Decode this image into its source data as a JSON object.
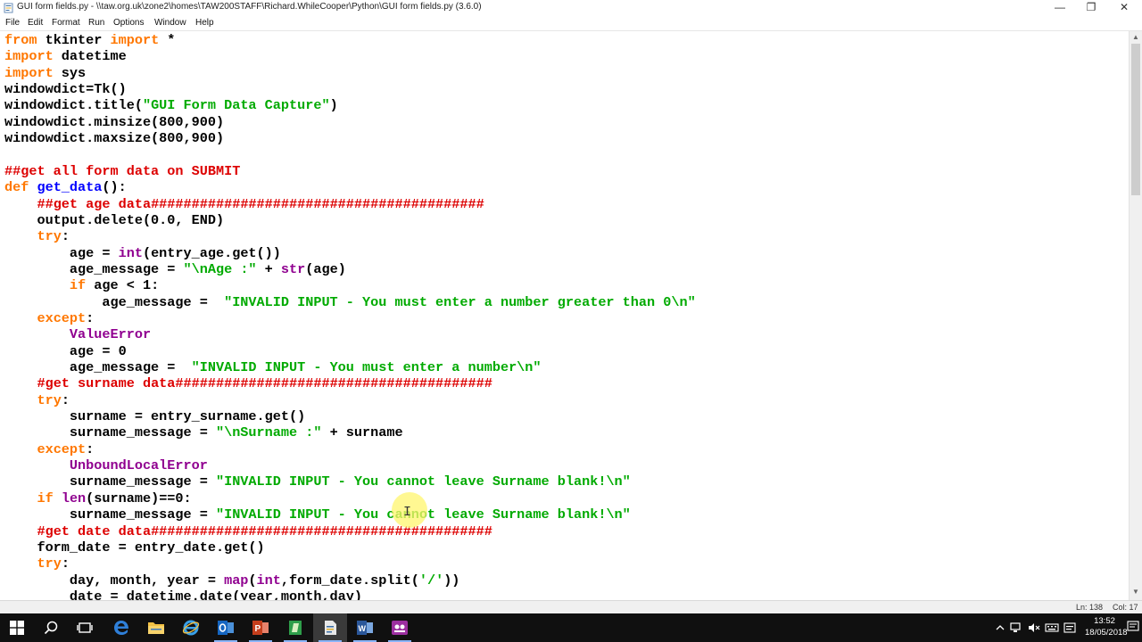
{
  "window": {
    "title": "GUI form fields.py - \\\\taw.org.uk\\zone2\\homes\\TAW200STAFF\\Richard.WhileCooper\\Python\\GUI form fields.py (3.6.0)",
    "minimize_glyph": "—",
    "maximize_glyph": "❐",
    "close_glyph": "✕"
  },
  "menu": {
    "items": [
      "File",
      "Edit",
      "Format",
      "Run",
      "Options",
      "Window",
      "Help"
    ]
  },
  "editor": {
    "lines": [
      [
        {
          "t": "from",
          "c": "kw"
        },
        {
          "t": " tkinter "
        },
        {
          "t": "import",
          "c": "kw"
        },
        {
          "t": " *"
        }
      ],
      [
        {
          "t": "import",
          "c": "kw"
        },
        {
          "t": " datetime"
        }
      ],
      [
        {
          "t": "import",
          "c": "kw"
        },
        {
          "t": " sys"
        }
      ],
      [
        {
          "t": "windowdict=Tk()"
        }
      ],
      [
        {
          "t": "windowdict.title("
        },
        {
          "t": "\"GUI Form Data Capture\"",
          "c": "str"
        },
        {
          "t": ")"
        }
      ],
      [
        {
          "t": "windowdict.minsize(800,900)"
        }
      ],
      [
        {
          "t": "windowdict.maxsize(800,900)"
        }
      ],
      [],
      [
        {
          "t": "##get all form data on SUBMIT",
          "c": "cm"
        }
      ],
      [
        {
          "t": "def",
          "c": "kw"
        },
        {
          "t": " "
        },
        {
          "t": "get_data",
          "c": "df"
        },
        {
          "t": "():"
        }
      ],
      [
        {
          "t": "    "
        },
        {
          "t": "##get age data#########################################",
          "c": "cm"
        }
      ],
      [
        {
          "t": "    output.delete(0.0, END)"
        }
      ],
      [
        {
          "t": "    "
        },
        {
          "t": "try",
          "c": "kw"
        },
        {
          "t": ":"
        }
      ],
      [
        {
          "t": "        age = "
        },
        {
          "t": "int",
          "c": "bi"
        },
        {
          "t": "(entry_age.get())"
        }
      ],
      [
        {
          "t": "        age_message = "
        },
        {
          "t": "\"\\nAge :\"",
          "c": "str"
        },
        {
          "t": " + "
        },
        {
          "t": "str",
          "c": "bi"
        },
        {
          "t": "(age)"
        }
      ],
      [
        {
          "t": "        "
        },
        {
          "t": "if",
          "c": "kw"
        },
        {
          "t": " age < 1:"
        }
      ],
      [
        {
          "t": "            age_message =  "
        },
        {
          "t": "\"INVALID INPUT - You must enter a number greater than 0\\n\"",
          "c": "str"
        }
      ],
      [
        {
          "t": "    "
        },
        {
          "t": "except",
          "c": "kw"
        },
        {
          "t": ":"
        }
      ],
      [
        {
          "t": "        "
        },
        {
          "t": "ValueError",
          "c": "bi"
        }
      ],
      [
        {
          "t": "        age = 0"
        }
      ],
      [
        {
          "t": "        age_message =  "
        },
        {
          "t": "\"INVALID INPUT - You must enter a number\\n\"",
          "c": "str"
        }
      ],
      [
        {
          "t": "    "
        },
        {
          "t": "#get surname data#######################################",
          "c": "cm"
        }
      ],
      [
        {
          "t": "    "
        },
        {
          "t": "try",
          "c": "kw"
        },
        {
          "t": ":"
        }
      ],
      [
        {
          "t": "        surname = entry_surname.get()"
        }
      ],
      [
        {
          "t": "        surname_message = "
        },
        {
          "t": "\"\\nSurname :\"",
          "c": "str"
        },
        {
          "t": " + surname"
        }
      ],
      [
        {
          "t": "    "
        },
        {
          "t": "except",
          "c": "kw"
        },
        {
          "t": ":"
        }
      ],
      [
        {
          "t": "        "
        },
        {
          "t": "UnboundLocalError",
          "c": "bi"
        }
      ],
      [
        {
          "t": "        surname_message = "
        },
        {
          "t": "\"INVALID INPUT - You cannot leave Surname blank!\\n\"",
          "c": "str"
        }
      ],
      [
        {
          "t": "    "
        },
        {
          "t": "if",
          "c": "kw"
        },
        {
          "t": " "
        },
        {
          "t": "len",
          "c": "bi"
        },
        {
          "t": "(surname)==0:"
        }
      ],
      [
        {
          "t": "        surname_message = "
        },
        {
          "t": "\"INVALID INPUT - You cannot leave Surname blank!\\n\"",
          "c": "str"
        }
      ],
      [
        {
          "t": "    "
        },
        {
          "t": "#get date data##########################################",
          "c": "cm"
        }
      ],
      [
        {
          "t": "    form_date = entry_date.get()"
        }
      ],
      [
        {
          "t": "    "
        },
        {
          "t": "try",
          "c": "kw"
        },
        {
          "t": ":"
        }
      ],
      [
        {
          "t": "        day, month, year = "
        },
        {
          "t": "map",
          "c": "bi"
        },
        {
          "t": "("
        },
        {
          "t": "int",
          "c": "bi"
        },
        {
          "t": ",form_date.split("
        },
        {
          "t": "'/'",
          "c": "str"
        },
        {
          "t": "))"
        }
      ],
      [
        {
          "t": "        date = datetime.date(year,month,day)"
        }
      ]
    ]
  },
  "scrollbar": {
    "up_glyph": "▲",
    "down_glyph": "▼"
  },
  "status": {
    "line": "Ln: 138",
    "col": "Col: 17"
  },
  "taskbar": {
    "apps": [
      {
        "name": "start-button",
        "icon": "windows-logo-icon"
      },
      {
        "name": "search-button",
        "icon": "search-icon"
      },
      {
        "name": "task-view-button",
        "icon": "task-view-icon"
      },
      {
        "name": "taskbar-edge",
        "icon": "edge-icon"
      },
      {
        "name": "taskbar-file-explorer",
        "icon": "folder-icon"
      },
      {
        "name": "taskbar-internet-explorer",
        "icon": "internet-explorer-icon"
      },
      {
        "name": "taskbar-outlook",
        "icon": "outlook-icon"
      },
      {
        "name": "taskbar-powerpoint",
        "icon": "powerpoint-icon"
      },
      {
        "name": "taskbar-python-idle",
        "icon": "python-idle-icon"
      },
      {
        "name": "taskbar-python-file",
        "icon": "python-file-icon"
      },
      {
        "name": "taskbar-word",
        "icon": "word-icon"
      },
      {
        "name": "taskbar-recorder",
        "icon": "screen-recorder-icon"
      }
    ],
    "clock": {
      "time": "13:52",
      "date": "18/05/2018"
    }
  },
  "colors": {
    "keyword": "#ff7700",
    "builtin": "#900090",
    "string": "#00aa00",
    "comment": "#dd0000",
    "definition": "#0000ff",
    "taskbar": "#101010"
  }
}
